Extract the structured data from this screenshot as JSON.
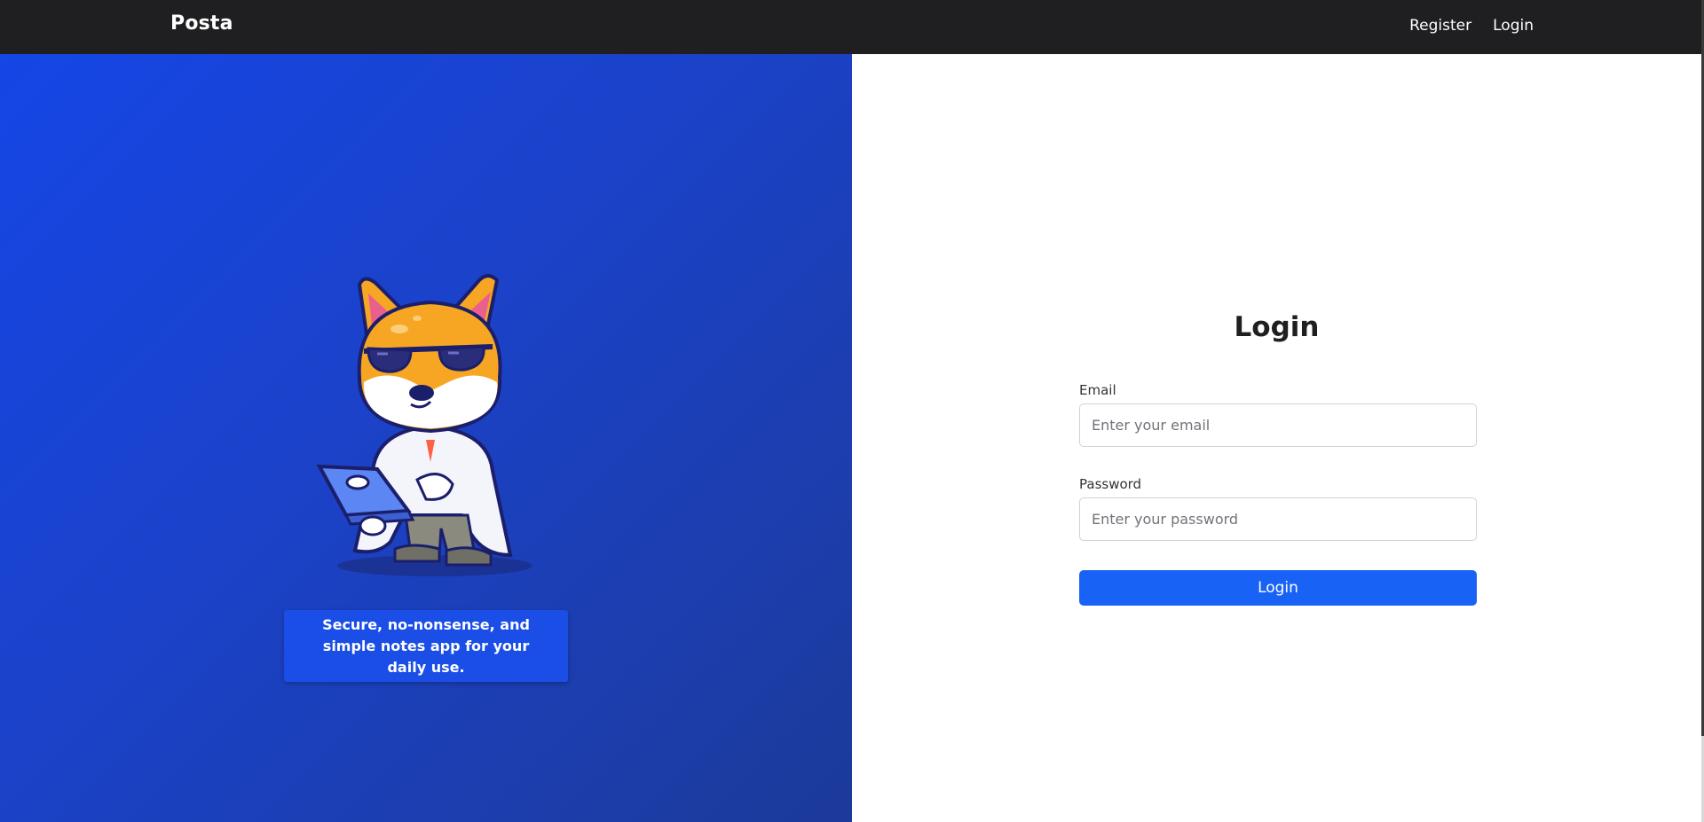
{
  "navbar": {
    "brand": "Posta",
    "links": [
      {
        "label": "Register"
      },
      {
        "label": "Login"
      }
    ]
  },
  "hero": {
    "mascot": "shiba-dog-with-laptop-illustration",
    "tagline": "Secure, no-nonsense, and simple notes app for your daily use."
  },
  "login_form": {
    "title": "Login",
    "email": {
      "label": "Email",
      "placeholder": "Enter your email",
      "value": ""
    },
    "password": {
      "label": "Password",
      "placeholder": "Enter your password",
      "value": ""
    },
    "submit_label": "Login"
  },
  "colors": {
    "navbar_bg": "#1f1f21",
    "hero_gradient_start": "#1546e6",
    "hero_gradient_end": "#1c3a9a",
    "primary_button": "#1862f5"
  }
}
